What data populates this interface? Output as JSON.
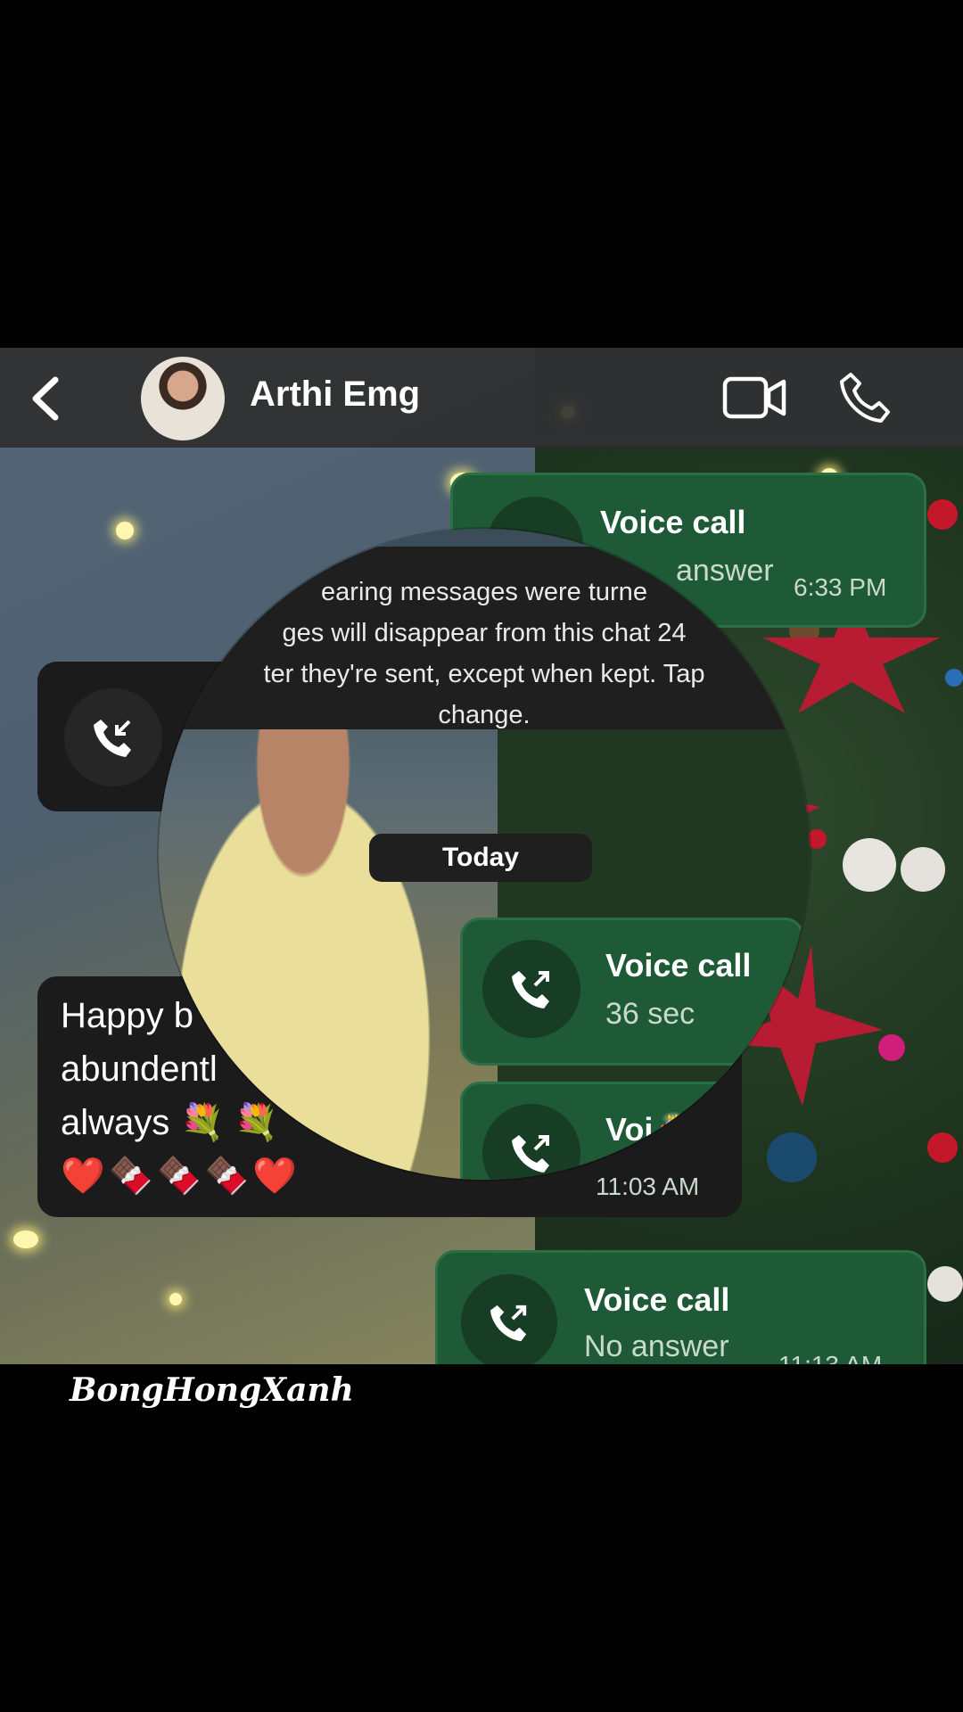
{
  "header": {
    "contact_name": "Arthi Emg",
    "back_icon": "chevron-left-icon",
    "video_icon": "video-camera-icon",
    "call_icon": "phone-icon"
  },
  "system": {
    "disappearing_notice": "earing messages were turne   ges will disappear from this chat 24  ter they're sent, except when kept. Tap",
    "notice_line1": "earing messages were turne",
    "notice_line2": "ges will disappear from this chat 24",
    "notice_line3": "ter they're sent, except when kept. Tap",
    "notice_line4": "change.",
    "date_divider": "Today"
  },
  "messages": [
    {
      "type": "call",
      "direction": "outgoing",
      "title": "Voice call",
      "sub": "No answer",
      "sub_visible": "answer",
      "time": "6:33 PM"
    },
    {
      "type": "call",
      "direction": "incoming",
      "title": "",
      "sub": "",
      "time": ""
    },
    {
      "type": "call",
      "direction": "outgoing",
      "title": "Voice call",
      "sub": "36 sec",
      "time": ""
    },
    {
      "type": "text",
      "direction": "incoming",
      "line1": "Happy b",
      "line2": "abundentl",
      "line3": "always",
      "emoji_row2": "💐 💐",
      "emoji_row3": "❤️🍫🍫🍫❤️"
    },
    {
      "type": "call",
      "direction": "outgoing",
      "title": "Voi",
      "title_suffix": "🎂",
      "sub": "",
      "time": "11:03 AM"
    },
    {
      "type": "call",
      "direction": "outgoing",
      "title": "Voice call",
      "sub": "No answer",
      "time": "11:13 AM"
    }
  ],
  "watermark": "BongHongXanh",
  "colors": {
    "bubble_green": "#1f5a36",
    "bubble_dark": "#1b1b1b",
    "header": "#2d2d2d"
  }
}
